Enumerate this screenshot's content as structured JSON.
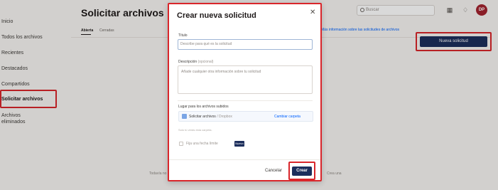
{
  "page": {
    "title": "Solicitar archivos",
    "tabs": [
      "Abierta",
      "Cerradas"
    ],
    "search_placeholder": "Buscar",
    "help_link": "Más información sobre las solicitudes de archivos",
    "new_request_button": "Nueva solicitud",
    "avatar_initials": "DP",
    "footer_note_left": "Todavía no hay solicitudes de archivos abiertas",
    "footer_note_right": "Crea una"
  },
  "sidebar": {
    "items": [
      {
        "label": "Inicio"
      },
      {
        "label": "Todos los archivos"
      },
      {
        "label": "Recientes"
      },
      {
        "label": "Destacados"
      },
      {
        "label": "Compartidos"
      },
      {
        "label": "Solicitar archivos",
        "active": true
      },
      {
        "label": "Archivos eliminados"
      }
    ]
  },
  "modal": {
    "title": "Crear nueva solicitud",
    "close_icon": "close-icon",
    "title_label": "Título",
    "title_placeholder": "Describe para qué es la solicitud",
    "description_label": "Descripción",
    "description_optional": "(opcional)",
    "description_placeholder": "Añade cualquier otra información sobre tu solicitud",
    "folder_label": "Lugar para los archivos subidos",
    "folder_name": "Solicitar archivos",
    "folder_path": "/ Dropbox",
    "change_folder": "Cambiar carpeta",
    "folder_hint": "Solo tú verás esta carpeta.",
    "deadline_label": "Fija una fecha límite",
    "new_badge": "Nuevo",
    "cancel_button": "Cancelar",
    "create_button": "Crear"
  },
  "colors": {
    "primary_button": "#1c2e5c",
    "highlight_border": "#d9262b",
    "link": "#0061fe"
  }
}
